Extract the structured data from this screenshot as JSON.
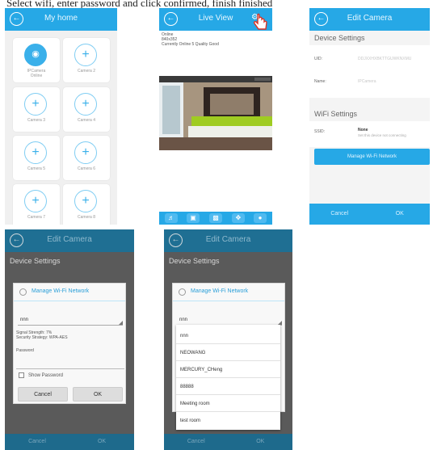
{
  "caption": "Select wifi, enter password and click confirmed, finish finished",
  "my_home": {
    "title": "My home",
    "cameras": [
      {
        "label": "IPCamera",
        "status": "Online"
      },
      {
        "label": "Camera 2"
      },
      {
        "label": "Camera 3"
      },
      {
        "label": "Camera 4"
      },
      {
        "label": "Camera 5"
      },
      {
        "label": "Camera 6"
      },
      {
        "label": "Camera 7"
      },
      {
        "label": "Camera 8"
      }
    ]
  },
  "live_view": {
    "title": "Live View",
    "status_lines": [
      "Online",
      "840x352",
      "Currently Online 5 Quality Good"
    ],
    "toolbar_icons": [
      "speaker-icon",
      "camera-icon",
      "image-icon",
      "arrows-icon",
      "bulb-icon"
    ]
  },
  "edit_camera": {
    "title": "Edit Camera",
    "device_settings": "Device Settings",
    "uid_label": "UID:",
    "uid_value": "DDJXXHXBKTTGUWKNXMU",
    "name_label": "Name:",
    "name_value": "IPCamera",
    "wifi_settings": "WiFi Settings",
    "ssid_label": "SSID:",
    "ssid_value": "None",
    "ssid_sub": "Set this device not connecting",
    "manage_button": "Manage Wi-Fi Network",
    "cancel": "Cancel",
    "ok": "OK"
  },
  "dialog_a": {
    "title": "Manage Wi-Fi Network",
    "ssid": "nnn",
    "signal": "Signal Strength: 7%",
    "security": "Security Strategy: WPA-AES",
    "password": "Password",
    "show_password": "Show Password",
    "cancel": "Cancel",
    "ok": "OK",
    "page_title": "Edit Camera",
    "device_settings": "Device Settings"
  },
  "dialog_b": {
    "title": "Manage Wi-Fi Network",
    "ssid": "nnn",
    "options": [
      "nnn",
      "NEOWANG",
      "MERCURY_CHeng",
      "88888",
      "Meeting room",
      "test room"
    ],
    "page_title": "Edit Camera",
    "device_settings": "Device Settings",
    "cancel": "Cancel",
    "ok": "OK"
  }
}
